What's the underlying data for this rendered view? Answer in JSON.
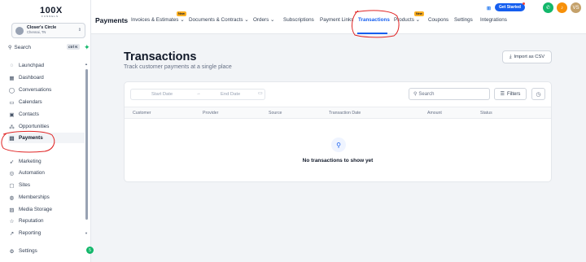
{
  "brand": {
    "logo": "100X",
    "logo_sub": "FUNNELS"
  },
  "account": {
    "name": "Closer's Circle",
    "location": "Chennai, TN"
  },
  "sidebar": {
    "search_label": "Search",
    "search_shortcut": "ctrl K",
    "items": [
      {
        "label": "Launchpad",
        "icon": "rocket-icon"
      },
      {
        "label": "Dashboard",
        "icon": "grid-icon"
      },
      {
        "label": "Conversations",
        "icon": "chat-icon"
      },
      {
        "label": "Calendars",
        "icon": "calendar-icon"
      },
      {
        "label": "Contacts",
        "icon": "contact-icon"
      },
      {
        "label": "Opportunities",
        "icon": "funnel-icon"
      },
      {
        "label": "Payments",
        "icon": "receipt-icon"
      },
      {
        "label": "Marketing",
        "icon": "send-icon"
      },
      {
        "label": "Automation",
        "icon": "automation-icon"
      },
      {
        "label": "Sites",
        "icon": "globe-icon"
      },
      {
        "label": "Memberships",
        "icon": "badge-icon"
      },
      {
        "label": "Media Storage",
        "icon": "image-icon"
      },
      {
        "label": "Reputation",
        "icon": "star-icon"
      },
      {
        "label": "Reporting",
        "icon": "chart-icon"
      }
    ],
    "settings_label": "Settings",
    "settings_badge": "5"
  },
  "topbar": {
    "title": "Payments",
    "tabs": [
      {
        "label": "Invoices & Estimates ⌄"
      },
      {
        "label": "Documents & Contracts ⌄"
      },
      {
        "label": "Orders ⌄"
      },
      {
        "label": "Subscriptions"
      },
      {
        "label": "Payment Links"
      },
      {
        "label": "Transactions"
      },
      {
        "label": "Products ⌄"
      },
      {
        "label": "Coupons"
      },
      {
        "label": "Settings"
      },
      {
        "label": "Integrations"
      }
    ],
    "new_badge": "New",
    "get_started": "Get Started",
    "user_initials": "VS"
  },
  "page": {
    "title": "Transactions",
    "subtitle": "Track customer payments at a single place",
    "import_label": "Import as CSV"
  },
  "filters": {
    "start_date_placeholder": "Start Date",
    "end_date_placeholder": "End Date",
    "search_placeholder": "Search",
    "filters_label": "Filters"
  },
  "table": {
    "columns": [
      "Customer",
      "Provider",
      "Source",
      "Transaction Date",
      "Amount",
      "Status"
    ],
    "empty_message": "No transactions to show yet"
  },
  "colors": {
    "accent": "#155eef",
    "annotation": "#e02424",
    "green": "#12b76a",
    "orange": "#f79009",
    "avatar": "#c4a16a"
  }
}
